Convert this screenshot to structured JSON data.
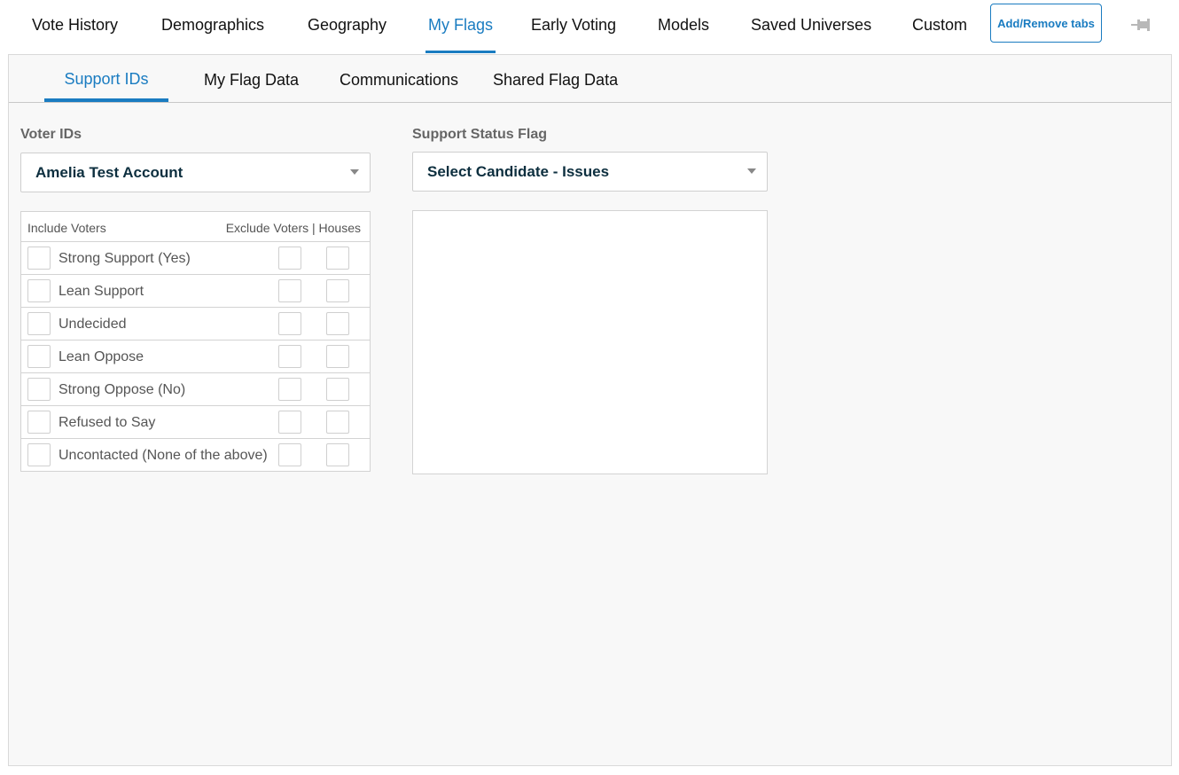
{
  "top_tabs": [
    {
      "label": "Vote History",
      "active": false
    },
    {
      "label": "Demographics",
      "active": false
    },
    {
      "label": "Geography",
      "active": false
    },
    {
      "label": "My Flags",
      "active": true
    },
    {
      "label": "Early Voting",
      "active": false
    },
    {
      "label": "Models",
      "active": false
    },
    {
      "label": "Saved Universes",
      "active": false
    },
    {
      "label": "Custom",
      "active": false
    }
  ],
  "add_remove_label": "Add/Remove tabs",
  "pin_icon": "pin-icon",
  "sub_tabs": [
    {
      "label": "Support IDs",
      "active": true
    },
    {
      "label": "My Flag Data",
      "active": false
    },
    {
      "label": "Communications",
      "active": false
    },
    {
      "label": "Shared Flag Data",
      "active": false
    }
  ],
  "voter_ids": {
    "label": "Voter IDs",
    "selected": "Amelia Test Account"
  },
  "support_status": {
    "label": "Support Status Flag",
    "selected": "Select Candidate - Issues"
  },
  "voter_table": {
    "include_header": "Include Voters",
    "exclude_header": "Exclude Voters | Houses",
    "rows": [
      {
        "label": "Strong Support (Yes)"
      },
      {
        "label": "Lean Support"
      },
      {
        "label": "Undecided"
      },
      {
        "label": "Lean Oppose"
      },
      {
        "label": "Strong Oppose (No)"
      },
      {
        "label": "Refused to Say"
      },
      {
        "label": "Uncontacted (None of the above)"
      }
    ]
  },
  "colors": {
    "accent": "#1a7cc1",
    "selected_text": "#0d2f3f"
  }
}
